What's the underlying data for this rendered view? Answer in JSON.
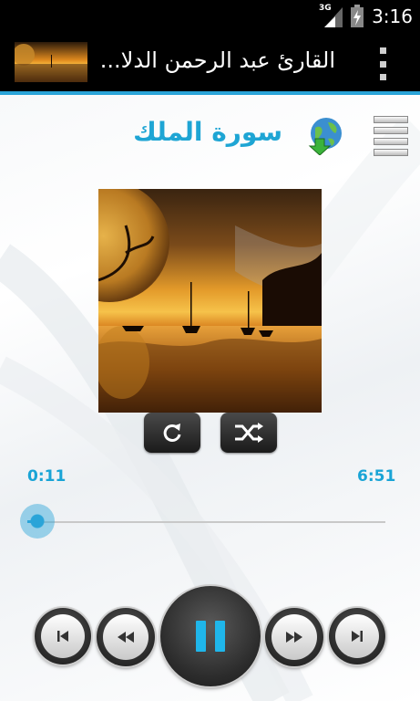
{
  "status_bar": {
    "time": "3:16",
    "network": "3G",
    "icons": [
      "signal-icon",
      "battery-icon"
    ]
  },
  "action_bar": {
    "title": "القارئ عبد الرحمن الدلا...",
    "menu_icon": "overflow-menu-icon"
  },
  "player": {
    "surah_title": "سورة الملك",
    "icons": {
      "menu": "list-menu-icon",
      "download": "globe-download-icon",
      "repeat": "repeat-icon",
      "shuffle": "shuffle-icon",
      "previous": "skip-previous-icon",
      "rewind": "rewind-icon",
      "pause": "pause-icon",
      "fast_forward": "fast-forward-icon",
      "next": "skip-next-icon"
    },
    "current_time": "0:11",
    "total_time": "6:51",
    "progress_fraction": 0.027
  },
  "colors": {
    "accent": "#1ea5d4",
    "status_bar": "#000000",
    "action_bar": "#000000"
  }
}
